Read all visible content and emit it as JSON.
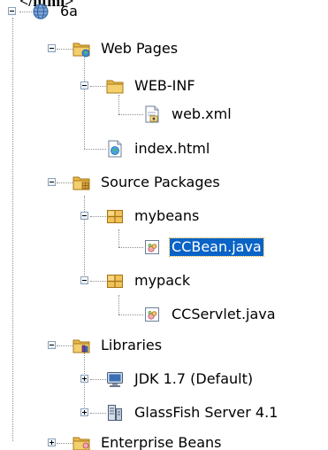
{
  "top_fragment": "</html>",
  "colors": {
    "selection_bg": "#0a63c6",
    "selection_text": "#ffffff",
    "folder": "#e8b84a",
    "tree_line": "#8f8f8f"
  },
  "tree": {
    "project": {
      "label": "6a",
      "icon": "globe-project-icon",
      "state": "expanded"
    },
    "web_pages": {
      "label": "Web Pages",
      "icon": "web-folder-icon",
      "state": "expanded"
    },
    "web_inf": {
      "label": "WEB-INF",
      "icon": "folder-icon",
      "state": "expanded"
    },
    "web_xml": {
      "label": "web.xml",
      "icon": "xml-file-icon"
    },
    "index_html": {
      "label": "index.html",
      "icon": "html-file-icon"
    },
    "source_packages": {
      "label": "Source Packages",
      "icon": "source-folder-icon",
      "state": "expanded"
    },
    "mybeans": {
      "label": "mybeans",
      "icon": "package-icon",
      "state": "expanded"
    },
    "ccbean": {
      "label": "CCBean.java",
      "icon": "java-file-icon",
      "selected": true
    },
    "mypack": {
      "label": "mypack",
      "icon": "package-icon",
      "state": "expanded"
    },
    "ccservlet": {
      "label": "CCServlet.java",
      "icon": "java-file-icon"
    },
    "libraries": {
      "label": "Libraries",
      "icon": "library-folder-icon",
      "state": "expanded"
    },
    "jdk": {
      "label": "JDK 1.7 (Default)",
      "icon": "jdk-monitor-icon",
      "state": "collapsed"
    },
    "glassfish": {
      "label": "GlassFish Server 4.1",
      "icon": "server-library-icon",
      "state": "collapsed"
    },
    "enterprise_beans": {
      "label": "Enterprise Beans",
      "icon": "beans-folder-icon",
      "state": "collapsed"
    }
  }
}
